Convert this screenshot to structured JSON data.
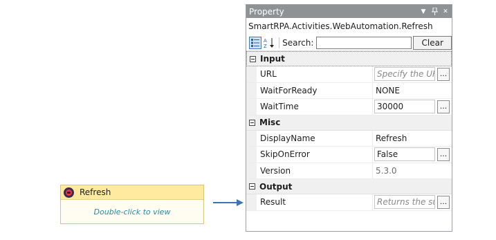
{
  "activity": {
    "title": "Refresh",
    "hint": "Double-click to view"
  },
  "panel": {
    "title": "Property",
    "type_name": "SmartRPA.Activities.WebAutomation.Refresh",
    "search_label": "Search:",
    "search_value": "",
    "clear_label": "Clear",
    "categories": [
      {
        "name": "Input",
        "props": [
          {
            "name": "URL",
            "value": "Specify the URL",
            "kind": "placeholder-ellipsis"
          },
          {
            "name": "WaitForReady",
            "value": "NONE",
            "kind": "plain"
          },
          {
            "name": "WaitTime",
            "value": "30000",
            "kind": "box-ellipsis"
          }
        ]
      },
      {
        "name": "Misc",
        "props": [
          {
            "name": "DisplayName",
            "value": "Refresh",
            "kind": "plain"
          },
          {
            "name": "SkipOnError",
            "value": "False",
            "kind": "box-ellipsis"
          },
          {
            "name": "Version",
            "value": "5.3.0",
            "kind": "readonly"
          }
        ]
      },
      {
        "name": "Output",
        "props": [
          {
            "name": "Result",
            "value": "Returns the suc",
            "kind": "placeholder-ellipsis"
          }
        ]
      }
    ],
    "ellipsis_label": "..."
  },
  "colors": {
    "titlebar": "#8f9294",
    "activity_header": "#ffeaa0",
    "arrow": "#3b72b8",
    "hint_text": "#2b8a9a"
  }
}
